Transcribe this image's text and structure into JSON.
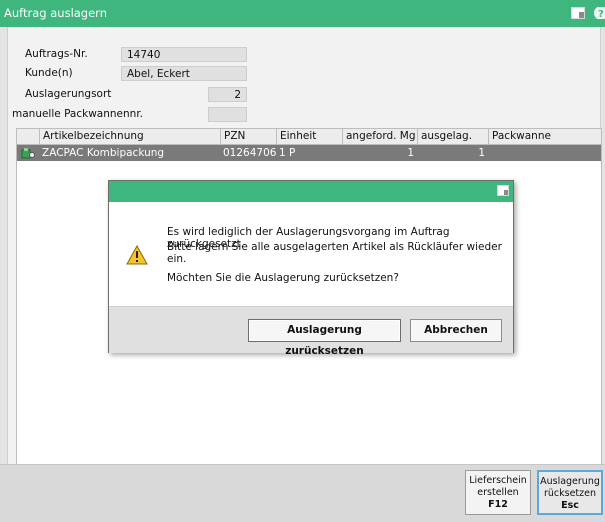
{
  "window": {
    "title": "Auftrag auslagern",
    "accent_color": "#3eb67e"
  },
  "form": {
    "order_no_label": "Auftrags-Nr.",
    "order_no_value": "14740",
    "customer_label": "Kunde(n)",
    "customer_value": "Abel, Eckert",
    "location_label": "Auslagerungsort",
    "location_value": "2",
    "manual_tray_label": "manuelle Packwannennr.",
    "manual_tray_value": ""
  },
  "table": {
    "columns": [
      "Artikelbezeichnung",
      "PZN",
      "Einheit",
      "angeford. Mg",
      "ausgelag. Mg",
      "Packwanne"
    ],
    "rows": [
      {
        "icon": "article-stock-icon",
        "name": "ZACPAC Kombipackung",
        "pzn": "01264706",
        "unit": "1 P",
        "requested": "1",
        "retrieved": "1",
        "tray": ""
      }
    ]
  },
  "dialog": {
    "icon": "warning-icon",
    "line1": "Es wird lediglich der Auslagerungsvorgang im Auftrag zurückgesetzt.",
    "line2": "Bitte lagern Sie alle ausgelagerten Artikel als Rückläufer wieder ein.",
    "line3": "Möchten Sie die Auslagerung zurücksetzen?",
    "confirm_label": "Auslagerung zurücksetzen",
    "cancel_label": "Abbrechen"
  },
  "footer": {
    "buttons": [
      {
        "line1": "Lieferschein",
        "line2": "erstellen",
        "key": "F12"
      },
      {
        "line1": "Auslagerung",
        "line2": "rücksetzen",
        "key": "Esc"
      }
    ]
  }
}
